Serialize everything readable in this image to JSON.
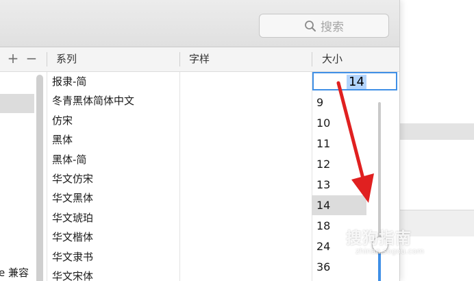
{
  "search": {
    "placeholder": "搜索"
  },
  "header": {
    "add_label": "+",
    "remove_label": "−",
    "family_col": "系列",
    "typeface_col": "字样",
    "size_col": "大小"
  },
  "collections": {
    "partial_item": "e 兼容"
  },
  "families": [
    "报隶-简",
    "冬青黑体简体中文",
    "仿宋",
    "黑体",
    "黑体-简",
    "华文仿宋",
    "华文黑体",
    "华文琥珀",
    "华文楷体",
    "华文隶书",
    "华文宋体"
  ],
  "size": {
    "current": "14",
    "options": [
      "9",
      "10",
      "11",
      "12",
      "13",
      "14",
      "18",
      "24",
      "36"
    ],
    "selected": "14"
  },
  "colors": {
    "accent": "#3f8fe6",
    "selection": "#dcdcdc",
    "annotation_arrow": "#e02020"
  },
  "watermark": {
    "title": "搜狗指南",
    "url": "zhinan.sogou.com"
  }
}
